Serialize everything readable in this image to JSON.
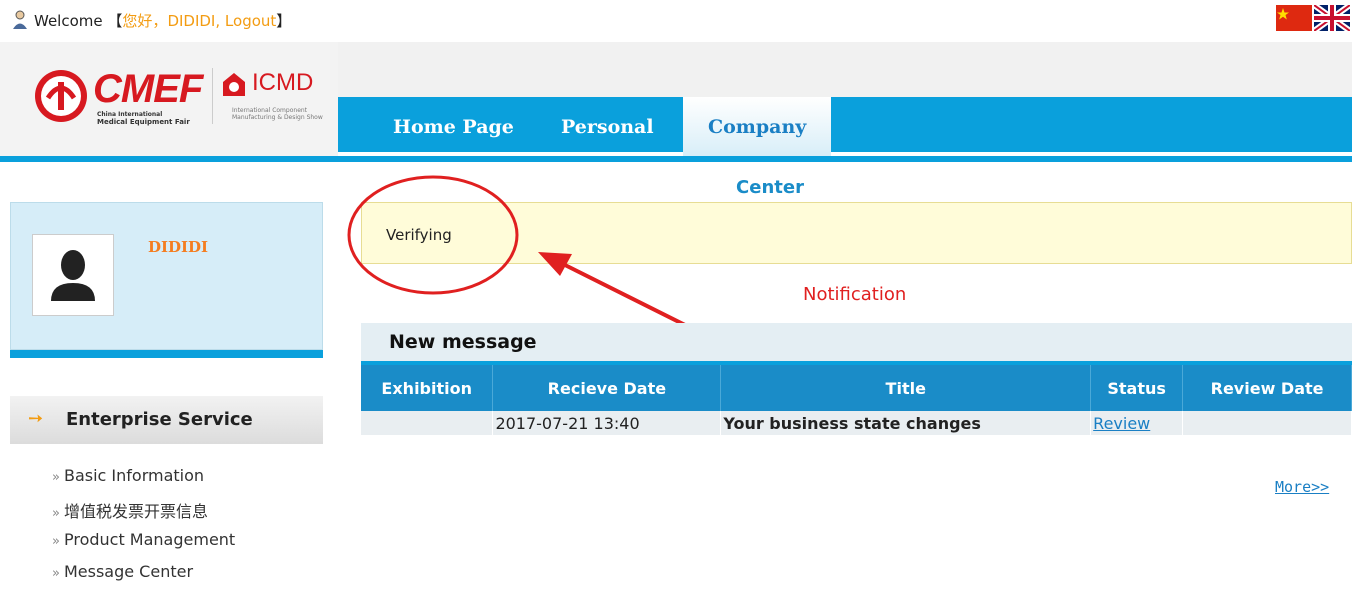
{
  "topbar": {
    "welcome": "Welcome",
    "bracket_open": "【",
    "greeting": "您好，",
    "user": "DIDIDI",
    "separator": ", ",
    "logout": "Logout",
    "bracket_close": "】"
  },
  "brand": {
    "cmef": "CMEF",
    "cmef_sub1": "China International",
    "cmef_sub2": "Medical Equipment Fair",
    "icmd": "ICMD",
    "icmd_sub1": "International Component",
    "icmd_sub2": "Manufacturing & Design Show"
  },
  "nav": {
    "items": [
      "Home Page",
      "Personal",
      "Company"
    ],
    "active": "Company"
  },
  "profile": {
    "username": "DIDIDI"
  },
  "enterprise_service": {
    "title": "Enterprise Service",
    "items": [
      "Basic Information",
      "增值税发票开票信息",
      "Product Management",
      "Message Center"
    ]
  },
  "main": {
    "center_title": "Center",
    "status_text": "Verifying",
    "annotation_label": "Notification",
    "messages": {
      "title": "New message",
      "columns": [
        "Exhibition",
        "Recieve Date",
        "Title",
        "Status",
        "Review Date"
      ],
      "rows": [
        {
          "exhibition": "",
          "date": "2017-07-21 13:40",
          "title": "Your business state changes",
          "status": "Review",
          "review_date": ""
        }
      ],
      "more": "More>>"
    }
  },
  "colors": {
    "accent": "#0aa0dc",
    "orange": "#f39c12",
    "annotation": "#e02020"
  }
}
